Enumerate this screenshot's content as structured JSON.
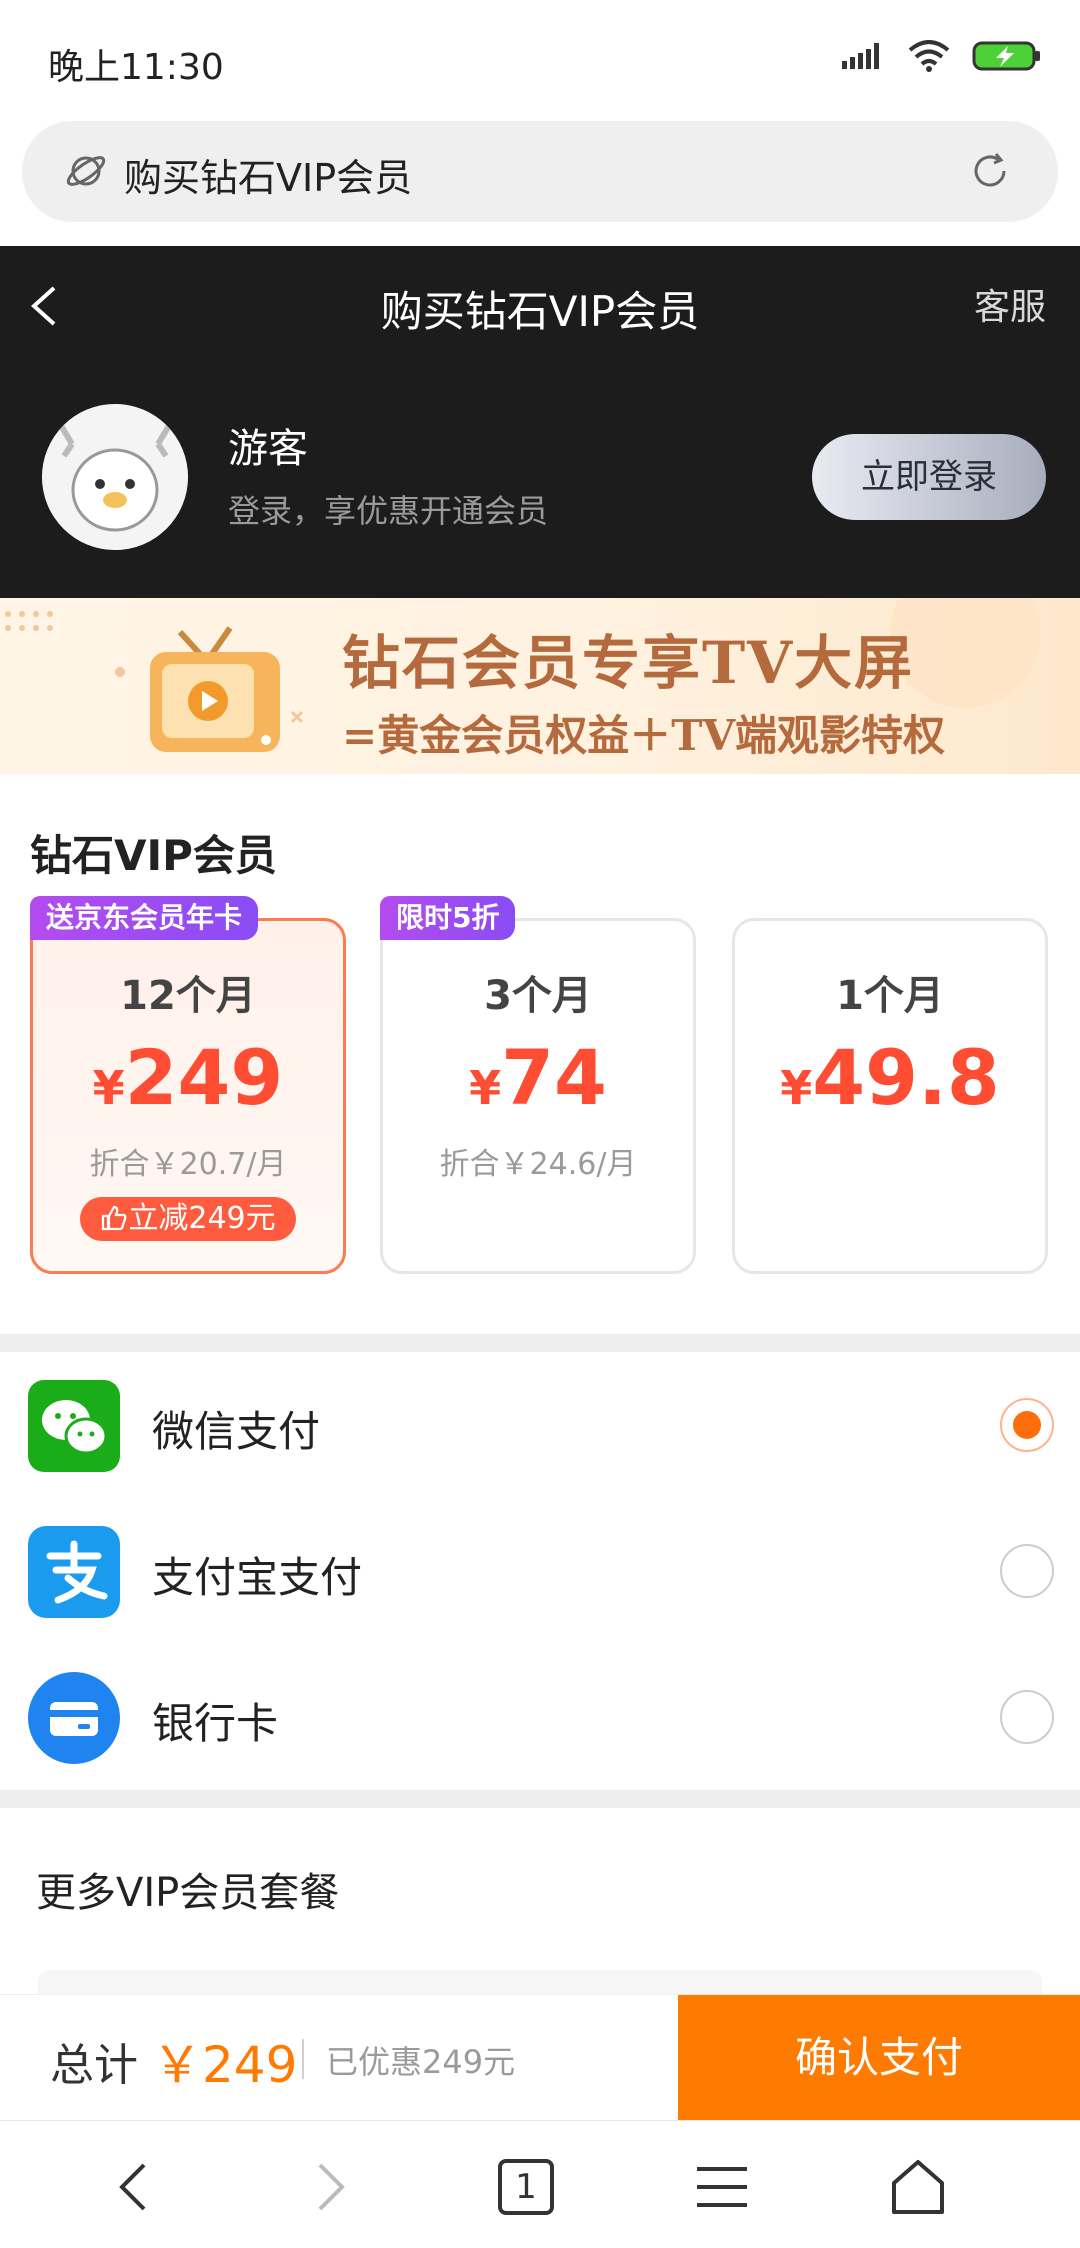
{
  "status_bar": {
    "time": "晚上11:30"
  },
  "address_bar": {
    "text": "购买钻石VIP会员"
  },
  "header": {
    "title": "购买钻石VIP会员",
    "service": "客服",
    "user_name": "游客",
    "user_sub": "登录，享优惠开通会员",
    "login_button": "立即登录"
  },
  "banner": {
    "line1": "钻石会员专享TV大屏",
    "line2": "=黄金会员权益＋TV端观影特权"
  },
  "plans": {
    "title": "钻石VIP会员",
    "currency": "¥",
    "items": [
      {
        "badge": "送京东会员年卡",
        "period": "12个月",
        "price": "249",
        "note": "折合￥20.7/月",
        "discount": "立减249元",
        "selected": true
      },
      {
        "badge": "限时5折",
        "period": "3个月",
        "price": "74",
        "note": "折合￥24.6/月",
        "selected": false
      },
      {
        "period": "1个月",
        "price": "49.8",
        "selected": false
      }
    ]
  },
  "payment": {
    "methods": [
      {
        "label": "微信支付",
        "icon": "wechat-pay-icon",
        "color": "#1aad19",
        "selected": true
      },
      {
        "label": "支付宝支付",
        "icon": "alipay-icon",
        "color": "#1a9bf0",
        "selected": false
      },
      {
        "label": "银行卡",
        "icon": "bank-card-icon",
        "color": "#1f84f0",
        "selected": false
      }
    ]
  },
  "more": {
    "title": "更多VIP会员套餐"
  },
  "pay_bar": {
    "total_label": "总计",
    "total_amount": "￥249",
    "saved": "已优惠249元",
    "confirm": "确认支付"
  },
  "browser_nav": {
    "tab_count": "1"
  },
  "colors": {
    "accent": "#ff7a00",
    "price": "#ff4d33",
    "header_bg": "#1c1c1c"
  }
}
